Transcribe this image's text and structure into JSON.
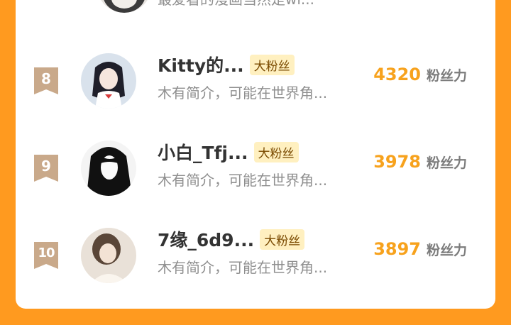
{
  "partial_row": {
    "desc": "最爱看的漫画当然是wi..."
  },
  "rows": [
    {
      "rank": "8",
      "name": "Kitty的...",
      "badge": "大粉丝",
      "desc": "木有简介，可能在世界角...",
      "score": "4320",
      "unit": "粉丝力"
    },
    {
      "rank": "9",
      "name": "小白_Tfj...",
      "badge": "大粉丝",
      "desc": "木有简介，可能在世界角...",
      "score": "3978",
      "unit": "粉丝力"
    },
    {
      "rank": "10",
      "name": "7缘_6d9...",
      "badge": "大粉丝",
      "desc": "木有简介，可能在世界角...",
      "score": "3897",
      "unit": "粉丝力"
    }
  ],
  "colors": {
    "background": "#ff9a1f",
    "rank_badge": "#c9a98a",
    "score": "#f7a21d",
    "fan_badge_bg": "#fff0c0"
  }
}
